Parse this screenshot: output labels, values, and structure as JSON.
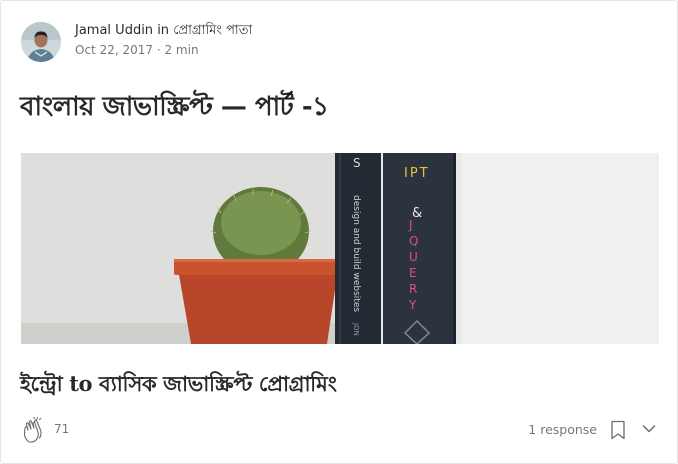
{
  "author": {
    "name": "Jamal Uddin",
    "in_word": "in",
    "publication": "প্রোগ্রামিং পাতা",
    "date": "Oct 22, 2017",
    "separator": "·",
    "read_time": "2 min"
  },
  "post": {
    "title": "বাংলায় জাভাস্ক্রিপ্ট — পার্ট -১",
    "subtitle": "ইন্ট্রো to ব্যাসিক জাভাস্ক্রিপ্ট প্রোগ্রামিং"
  },
  "hero_image": {
    "book_left_text": "design and build websites",
    "book_left_letter": "S",
    "book_right_text_a": "IPT",
    "book_right_text_b": "&",
    "book_right_text_c": "JQUERY",
    "book_left_spine_footer": "JON"
  },
  "footer": {
    "clap_count": "71",
    "responses_label": "1 response"
  },
  "icons": {
    "clap": "clap-icon",
    "bookmark": "bookmark-icon",
    "more": "chevron-down-icon"
  },
  "colors": {
    "text_primary": "#292929",
    "text_secondary": "#757575",
    "pot": "#c0442a",
    "book_spine": "#2a323d",
    "accent_yellow": "#e7c33a",
    "accent_pink": "#e44a7d"
  }
}
